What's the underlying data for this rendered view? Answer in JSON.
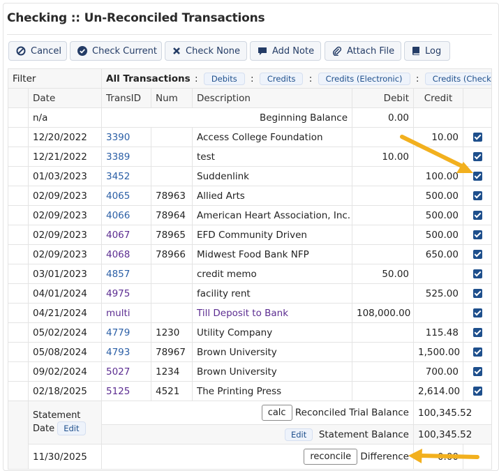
{
  "page": {
    "title": "Checking :: Un-Reconciled Transactions"
  },
  "toolbar": {
    "cancel": "Cancel",
    "check_current": "Check Current",
    "check_none": "Check None",
    "add_note": "Add Note",
    "attach_file": "Attach File",
    "log": "Log"
  },
  "filter": {
    "label": "Filter",
    "all_label": "All Transactions",
    "colon": ":",
    "options": [
      "Debits",
      "Credits",
      "Credits (Electronic)",
      "Credits (Checks)"
    ]
  },
  "columns": {
    "date": "Date",
    "transid": "TransID",
    "num": "Num",
    "description": "Description",
    "debit": "Debit",
    "credit": "Credit"
  },
  "beginning": {
    "date": "n/a",
    "label": "Beginning Balance",
    "debit": "0.00"
  },
  "rows": [
    {
      "date": "12/20/2022",
      "transid": "3390",
      "num": "",
      "description": "Access College Foundation",
      "debit": "",
      "credit": "10.00"
    },
    {
      "date": "12/21/2022",
      "transid": "3389",
      "num": "",
      "description": "test",
      "debit": "10.00",
      "credit": ""
    },
    {
      "date": "01/03/2023",
      "transid": "3452",
      "num": "",
      "description": "Suddenlink",
      "debit": "",
      "credit": "100.00"
    },
    {
      "date": "02/09/2023",
      "transid": "4065",
      "num": "78963",
      "description": "Allied Arts",
      "debit": "",
      "credit": "500.00"
    },
    {
      "date": "02/09/2023",
      "transid": "4066",
      "num": "78964",
      "description": "American Heart Association, Inc.",
      "debit": "",
      "credit": "500.00"
    },
    {
      "date": "02/09/2023",
      "transid": "4067",
      "num": "78965",
      "description": "EFD Community Driven",
      "debit": "",
      "credit": "500.00"
    },
    {
      "date": "02/09/2023",
      "transid": "4068",
      "num": "78966",
      "description": "Midwest Food Bank NFP",
      "debit": "",
      "credit": "650.00"
    },
    {
      "date": "03/01/2023",
      "transid": "4857",
      "num": "",
      "description": "credit memo",
      "debit": "50.00",
      "credit": ""
    },
    {
      "date": "04/01/2024",
      "transid": "4975",
      "num": "",
      "description": "facility rent",
      "debit": "",
      "credit": "525.00"
    },
    {
      "date": "04/21/2024",
      "transid": "multi",
      "num": "",
      "description": "Till Deposit to Bank",
      "debit": "108,000.00",
      "credit": ""
    },
    {
      "date": "05/02/2024",
      "transid": "4779",
      "num": "1230",
      "description": "Utility Company",
      "debit": "",
      "credit": "115.48"
    },
    {
      "date": "05/08/2024",
      "transid": "4793",
      "num": "78967",
      "description": "Brown University",
      "debit": "",
      "credit": "1,500.00"
    },
    {
      "date": "09/02/2024",
      "transid": "5027",
      "num": "1234",
      "description": "Brown University",
      "debit": "",
      "credit": "700.00"
    },
    {
      "date": "02/18/2025",
      "transid": "5125",
      "num": "4521",
      "description": "The Printing Press",
      "debit": "",
      "credit": "2,614.00"
    }
  ],
  "footer": {
    "statement_label": "Statement Date",
    "edit": "Edit",
    "date": "11/30/2025",
    "calc": "calc",
    "reconciled_label": "Reconciled Trial Balance",
    "reconciled_value": "100,345.52",
    "statement_balance_label": "Statement Balance",
    "statement_balance_value": "100,345.52",
    "reconcile": "reconcile",
    "difference_label": "Difference",
    "difference_value": "0.00"
  },
  "colors": {
    "accent": "#1e4f8c",
    "link": "#2b5fa6",
    "visited": "#5c2d91",
    "arrow": "#f2b01e"
  }
}
